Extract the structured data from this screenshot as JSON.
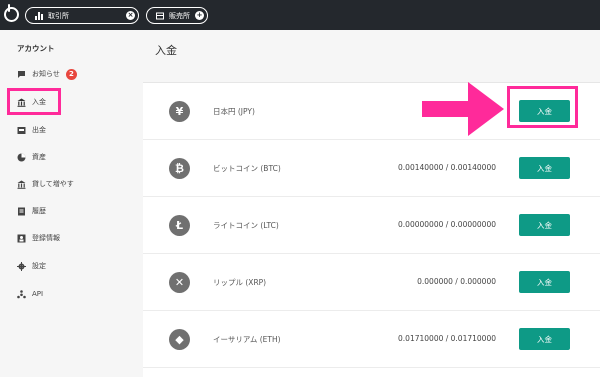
{
  "topbar": {
    "tabs": [
      {
        "label": "取引所",
        "icon": "chart-bars-icon"
      },
      {
        "label": "販売所",
        "icon": "store-icon"
      }
    ]
  },
  "sidebar": {
    "heading": "アカウント",
    "items": [
      {
        "label": "お知らせ",
        "icon": "message-icon",
        "badge": "2"
      },
      {
        "label": "入金",
        "icon": "bank-icon",
        "active": true
      },
      {
        "label": "出金",
        "icon": "withdraw-icon"
      },
      {
        "label": "資産",
        "icon": "pie-chart-icon"
      },
      {
        "label": "貸して増やす",
        "icon": "lending-icon"
      },
      {
        "label": "履歴",
        "icon": "history-icon"
      },
      {
        "label": "登録情報",
        "icon": "profile-icon"
      },
      {
        "label": "設定",
        "icon": "gear-icon"
      },
      {
        "label": "API",
        "icon": "api-icon"
      }
    ]
  },
  "main": {
    "title": "入金",
    "rows": [
      {
        "name": "日本円 (JPY)",
        "symbol": "¥",
        "balance": "",
        "button": "入金"
      },
      {
        "name": "ビットコイン (BTC)",
        "symbol": "₿",
        "balance": "0.00140000 / 0.00140000",
        "button": "入金"
      },
      {
        "name": "ライトコイン (LTC)",
        "symbol": "Ł",
        "balance": "0.00000000 / 0.00000000",
        "button": "入金"
      },
      {
        "name": "リップル (XRP)",
        "symbol": "✕",
        "balance": "0.000000 / 0.000000",
        "button": "入金"
      },
      {
        "name": "イーサリアム (ETH)",
        "symbol": "◆",
        "balance": "0.01710000 / 0.01710000",
        "button": "入金"
      }
    ]
  },
  "colors": {
    "accent": "#0e9a86",
    "highlight": "#ff2a9a",
    "topbar": "#24282d",
    "badge": "#e8463e"
  }
}
